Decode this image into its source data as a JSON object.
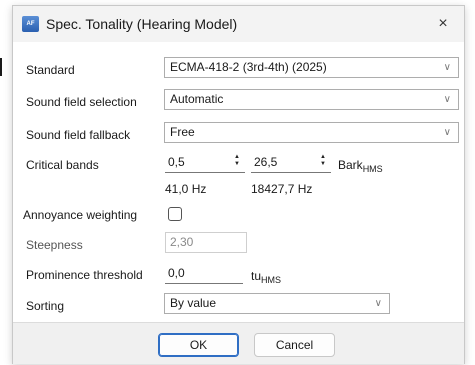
{
  "window": {
    "title": "Spec. Tonality (Hearing Model)",
    "icon": "app-icon",
    "icon_text": "Å\nFUN",
    "close": "×"
  },
  "fields": {
    "standard": {
      "label": "Standard",
      "value": "ECMA-418-2 (3rd-4th) (2025)"
    },
    "sound_field_selection": {
      "label": "Sound field selection",
      "value": "Automatic"
    },
    "sound_field_fallback": {
      "label": "Sound field fallback",
      "value": "Free"
    },
    "critical_bands": {
      "label": "Critical bands",
      "from": "0,5",
      "to": "26,5",
      "unit": "Bark",
      "unit_sub": "HMS",
      "from_hz": "41,0 Hz",
      "to_hz": "18427,7 Hz"
    },
    "annoyance_weighting": {
      "label": "Annoyance weighting",
      "checked": false
    },
    "steepness": {
      "label": "Steepness",
      "value": "2,30"
    },
    "prominence_threshold": {
      "label": "Prominence threshold",
      "value": "0,0",
      "unit": "tu",
      "unit_sub": "HMS"
    },
    "sorting": {
      "label": "Sorting",
      "value": "By value"
    }
  },
  "buttons": {
    "ok": "OK",
    "cancel": "Cancel"
  }
}
